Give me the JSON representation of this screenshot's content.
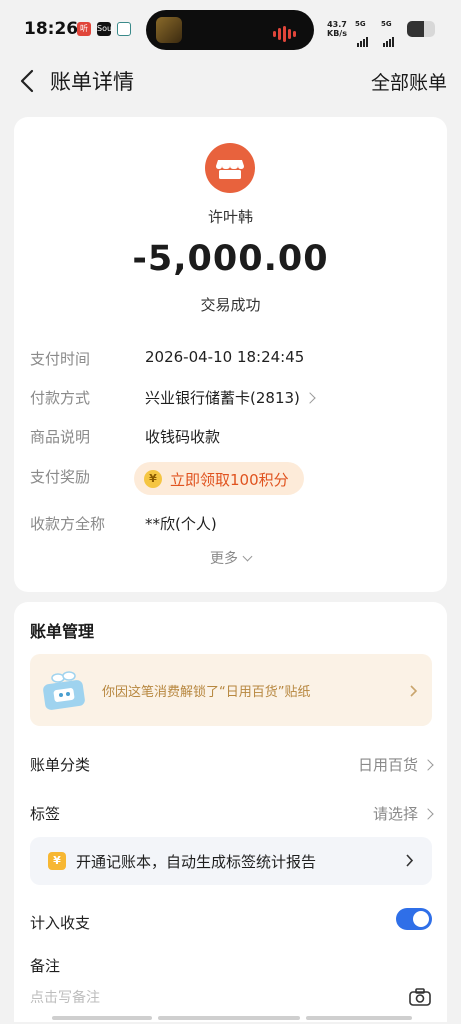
{
  "status_bar": {
    "time": "18:26",
    "net_speed_value": "43.7",
    "net_speed_unit": "KB/s",
    "sim1": "5G",
    "sim2": "5G",
    "battery_level": 0.62
  },
  "header": {
    "title": "账单详情",
    "right_link": "全部账单"
  },
  "transaction": {
    "merchant_name": "许叶韩",
    "amount": "-5,000.00",
    "status": "交易成功",
    "details": [
      {
        "label": "支付时间",
        "value": "2026-04-10 18:24:45"
      },
      {
        "label": "付款方式",
        "value": "兴业银行储蓄卡(2813)"
      },
      {
        "label": "商品说明",
        "value": "收钱码收款"
      },
      {
        "label": "支付奖励",
        "value": ""
      },
      {
        "label": "收款方全称",
        "value": "**欣(个人)"
      }
    ],
    "reward_text": "立即领取100积分",
    "more_label": "更多"
  },
  "management": {
    "title": "账单管理",
    "sticker_text": "你因这笔消费解锁了“日用百货”贴纸",
    "category_label": "账单分类",
    "category_value": "日用百货",
    "tag_label": "标签",
    "tag_value": "请选择",
    "banner_text": "开通记账本，自动生成标签统计报告",
    "count_label": "计入收支",
    "count_enabled": true,
    "note_label": "备注",
    "note_placeholder": "点击写备注"
  },
  "colors": {
    "merchant_icon": "#e8623d",
    "reward_text": "#e0531f",
    "toggle_on": "#2f6fe8",
    "sticker_text": "#b7873f"
  }
}
